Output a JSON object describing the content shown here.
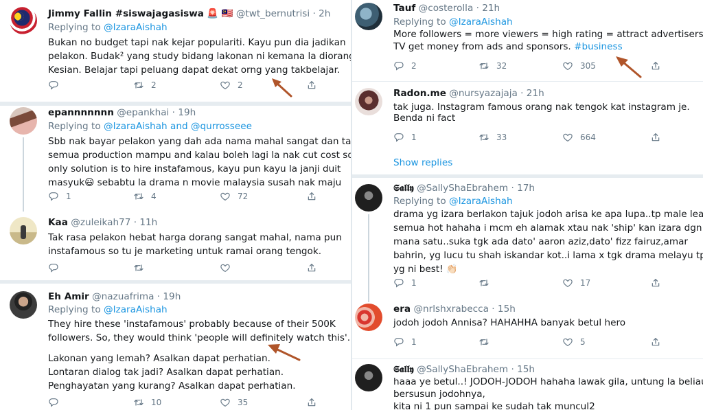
{
  "colors": {
    "link": "#1b95e0",
    "muted": "#657786",
    "text": "#14171a",
    "arrow": "#b0552a"
  },
  "left": [
    {
      "name": "Jimmy Fallin #siswajagasiswa",
      "emoji": "🚨 🇲🇾",
      "handle": "@twt_bernutrisi",
      "time": "· 2h",
      "replying": "Replying to",
      "replying_to": "@IzaraAishah",
      "lines": [
        "Bukan no budget tapi nak kejar populariti. Kayu pun dia jadikan",
        "pelakon. Budak² yang study bidang lakonan ni kemana la diorang",
        "Kesian. Belajar tapi peluang dapat dekat orng yang takbelajar."
      ],
      "replies": "",
      "retweets": "2",
      "likes": "2"
    },
    {
      "name": "epannnnnnn",
      "handle": "@epankhai",
      "time": "· 19h",
      "replying": "Replying to",
      "replying_to": "@IzaraAishah and @qurrosseee",
      "lines": [
        "Sbb nak bayar pelakon yang dah ada nama mahal sangat dan tak",
        "semua production mampu and kalau boleh lagi la nak cut cost so",
        "only solution is to hire instafamous, kayu pun kayu la janji duit",
        "masyuk😃 sebabtu la drama n movie malaysia susah nak maju"
      ],
      "replies": "1",
      "retweets": "4",
      "likes": "72"
    },
    {
      "name": "Kaa",
      "handle": "@zuleikah77",
      "time": "· 11h",
      "lines": [
        "Tak rasa pelakon hebat harga dorang sangat mahal, nama pun",
        "instafamous so tu je marketing untuk ramai orang tengok."
      ],
      "replies": "",
      "retweets": "",
      "likes": ""
    },
    {
      "name": "Eh Amir",
      "handle": "@nazuafrima",
      "time": "· 19h",
      "replying": "Replying to",
      "replying_to": "@IzaraAishah",
      "lines": [
        "They hire these 'instafamous' probably because of their 500K",
        "followers. So, they would think 'people will definitely watch this'.",
        "",
        "Lakonan yang lemah? Asalkan dapat perhatian.",
        " Lontaran dialog tak jadi? Asalkan dapat perhatian.",
        "Penghayatan yang kurang? Asalkan dapat perhatian."
      ],
      "replies": "",
      "retweets": "10",
      "likes": "35"
    }
  ],
  "right": [
    {
      "name": "Tauf",
      "handle": "@costerolla",
      "time": "· 21h",
      "replying": "Replying to",
      "replying_to": "@IzaraAishah",
      "lines": [
        "More followers = more viewers = high rating = attract advertisers =",
        "TV get money from ads and sponsors."
      ],
      "hashtag": "#business",
      "replies": "2",
      "retweets": "32",
      "likes": "305"
    },
    {
      "name": "Radon.me",
      "handle": "@nursyazajaja",
      "time": "· 21h",
      "lines": [
        "tak juga. Instagram famous orang nak tengok kat instagram je.",
        "Benda ni fact"
      ],
      "replies": "1",
      "retweets": "33",
      "likes": "664",
      "show_replies": "Show replies"
    },
    {
      "name": "𝕾𝖆𝖑𝖑𝖞",
      "handle": "@SallyShaEbrahem",
      "time": "· 17h",
      "replying": "Replying to",
      "replying_to": "@IzaraAishah",
      "lines": [
        "drama yg izara berlakon tajuk jodoh arisa ke apa lupa..tp male lead",
        "semua hot hahaha i mcm eh alamak xtau nak 'ship' kan izara dgn y",
        "mana satu..suka tgk ada dato' aaron aziz,dato' fizz fairuz,amar",
        "bahrin, yg lucu tu shah iskandar kot..i lama x tgk drama melayu tp",
        "yg ni best! 👏🏻"
      ],
      "replies": "1",
      "retweets": "",
      "likes": "17"
    },
    {
      "name": "era",
      "handle": "@nrlshxrabecca",
      "time": "· 15h",
      "lines": [
        "jodoh jodoh Annisa? HAHAHHA banyak betul hero"
      ],
      "replies": "1",
      "retweets": "",
      "likes": "5"
    },
    {
      "name": "𝕾𝖆𝖑𝖑𝖞",
      "handle": "@SallyShaEbrahem",
      "time": "· 15h",
      "lines": [
        "haaa ye betul..! JODOH-JODOH hahaha lawak gila, untung la beliau",
        "bersusun jodohnya,",
        "kita ni 1 pun sampai ke sudah tak muncul2"
      ]
    }
  ]
}
